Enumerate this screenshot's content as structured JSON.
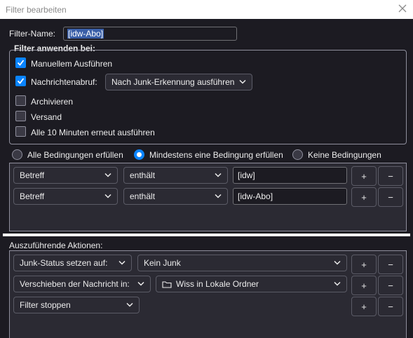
{
  "window": {
    "title": "Filter bearbeiten"
  },
  "filter_name": {
    "label": "Filter-Name:",
    "value": "[idw-Abo]"
  },
  "apply_group": {
    "legend": "Filter anwenden bei:",
    "manual_run": {
      "label": "Manuellem Ausführen",
      "checked": true
    },
    "fetch": {
      "label": "Nachrichtenabruf:",
      "checked": true,
      "dropdown": "Nach Junk-Erkennung ausführen"
    },
    "archive": {
      "label": "Archivieren",
      "checked": false
    },
    "send": {
      "label": "Versand",
      "checked": false
    },
    "periodic": {
      "label": "Alle 10 Minuten erneut ausführen",
      "checked": false
    }
  },
  "match_mode": {
    "options": [
      "Alle Bedingungen erfüllen",
      "Mindestens eine Bedingung erfüllen",
      "Keine Bedingungen"
    ],
    "selected": "Mindestens eine Bedingung erfüllen"
  },
  "conditions": [
    {
      "field": "Betreff",
      "operator": "enthält",
      "value": "[idw]"
    },
    {
      "field": "Betreff",
      "operator": "enthält",
      "value": "[idw-Abo]"
    }
  ],
  "actions_section": {
    "label": "Auszuführende Aktionen:"
  },
  "actions": [
    {
      "action": "Junk-Status setzen auf:",
      "target": "Kein Junk"
    },
    {
      "action": "Verschieben der Nachricht in:",
      "target": "Wiss in Lokale Ordner",
      "target_icon": "folder-icon"
    },
    {
      "action": "Filter stoppen",
      "target": ""
    }
  ],
  "buttons": {
    "add": "+",
    "remove": "−"
  },
  "colors": {
    "accent": "#0a84ff",
    "background": "#1c1b22",
    "control": "#2b2a33"
  }
}
